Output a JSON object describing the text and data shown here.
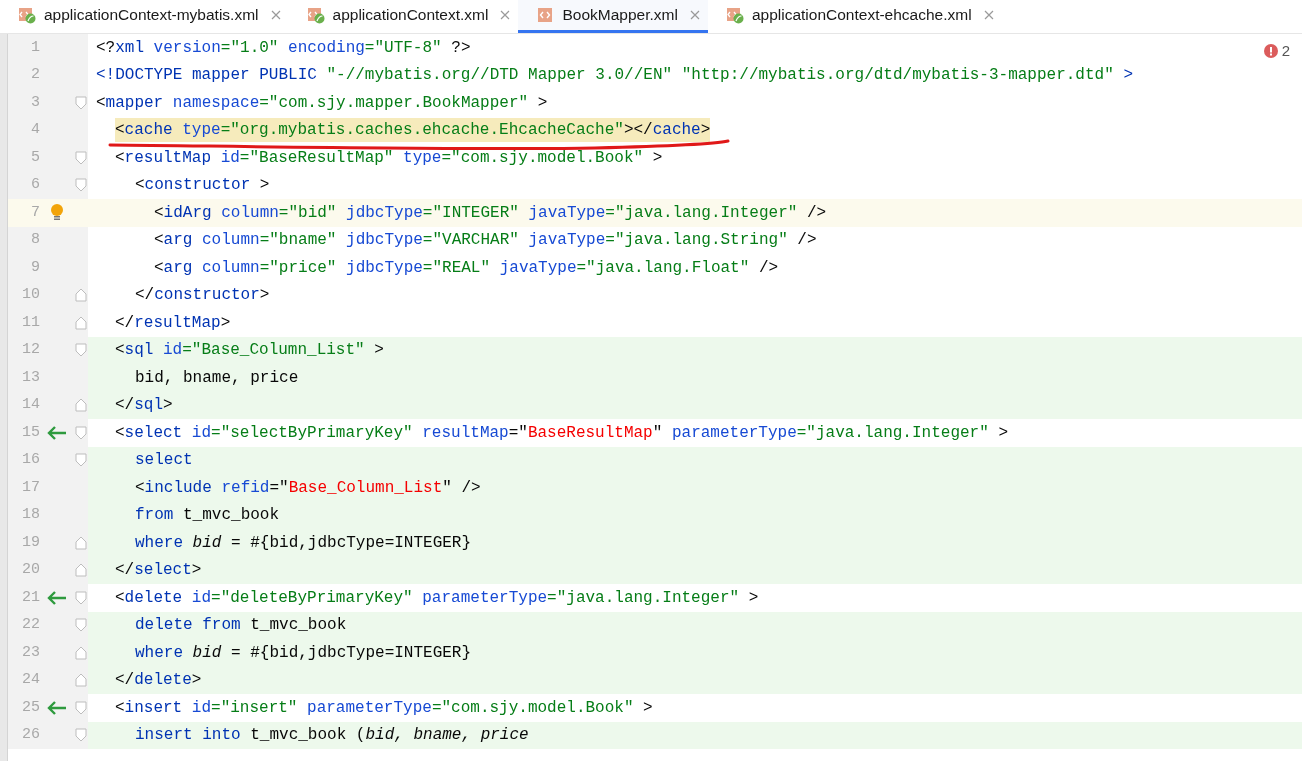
{
  "tabs": [
    {
      "label": "applicationContext-mybatis.xml",
      "selected": false,
      "kind": "spring"
    },
    {
      "label": "applicationContext.xml",
      "selected": false,
      "kind": "spring"
    },
    {
      "label": "BookMapper.xml",
      "selected": true,
      "kind": "xml"
    },
    {
      "label": "applicationContext-ehcache.xml",
      "selected": false,
      "kind": "spring"
    }
  ],
  "problems": {
    "errors": "2"
  },
  "lines": [
    {
      "number": "1",
      "fold_open": false,
      "fold_close": false,
      "arrow": false,
      "bulb": false,
      "changed": false,
      "current": false,
      "highlight": false,
      "tokens": [
        {
          "kind": "punct",
          "text": "<?"
        },
        {
          "kind": "tag",
          "text": "xml "
        },
        {
          "kind": "attr",
          "text": "version"
        },
        {
          "kind": "value",
          "text": "=\"1.0\" "
        },
        {
          "kind": "attr",
          "text": "encoding"
        },
        {
          "kind": "value",
          "text": "=\"UTF-8\" "
        },
        {
          "kind": "punct",
          "text": "?>"
        }
      ]
    },
    {
      "number": "2",
      "fold_open": false,
      "fold_close": false,
      "arrow": false,
      "bulb": false,
      "changed": false,
      "current": false,
      "highlight": false,
      "tokens": [
        {
          "kind": "tag",
          "text": "<!DOCTYPE mapper PUBLIC "
        },
        {
          "kind": "value",
          "text": "\"-//mybatis.org//DTD Mapper 3.0//EN\" \"http://mybatis.org/dtd/mybatis-3-mapper.dtd\" "
        },
        {
          "kind": "tag",
          "text": ">"
        }
      ]
    },
    {
      "number": "3",
      "fold_open": true,
      "fold_close": false,
      "arrow": false,
      "bulb": false,
      "changed": false,
      "current": false,
      "highlight": false,
      "tokens": [
        {
          "kind": "punct",
          "text": "<"
        },
        {
          "kind": "tag",
          "text": "mapper "
        },
        {
          "kind": "attr",
          "text": "namespace"
        },
        {
          "kind": "value",
          "text": "=\"com.sjy.mapper.BookMapper\" "
        },
        {
          "kind": "punct",
          "text": ">"
        }
      ],
      "children": [
        {
          "number": "4",
          "fold_open": false,
          "fold_close": false,
          "arrow": false,
          "bulb": false,
          "changed": false,
          "current": false,
          "highlight": true,
          "tokens": [
            {
              "kind": "punct",
              "text": "<"
            },
            {
              "kind": "tag",
              "text": "cache "
            },
            {
              "kind": "attr",
              "text": "type"
            },
            {
              "kind": "value",
              "text": "=\"org.mybatis.caches.ehcache.EhcacheCache\""
            },
            {
              "kind": "punct",
              "text": "></"
            },
            {
              "kind": "tag",
              "text": "cache"
            },
            {
              "kind": "punct",
              "text": ">"
            }
          ]
        },
        {
          "number": "5",
          "fold_open": true,
          "fold_close": false,
          "arrow": false,
          "bulb": false,
          "changed": false,
          "current": false,
          "highlight": false,
          "tokens": [
            {
              "kind": "punct",
              "text": "<"
            },
            {
              "kind": "tag",
              "text": "resultMap "
            },
            {
              "kind": "attr",
              "text": "id"
            },
            {
              "kind": "value",
              "text": "=\"BaseResultMap\" "
            },
            {
              "kind": "attr",
              "text": "type"
            },
            {
              "kind": "value",
              "text": "=\"com.sjy.model.Book\" "
            },
            {
              "kind": "punct",
              "text": ">"
            }
          ],
          "children": [
            {
              "number": "6",
              "fold_open": true,
              "fold_close": false,
              "arrow": false,
              "bulb": false,
              "changed": false,
              "current": false,
              "highlight": false,
              "tokens": [
                {
                  "kind": "punct",
                  "text": "<"
                },
                {
                  "kind": "tag",
                  "text": "constructor "
                },
                {
                  "kind": "punct",
                  "text": ">"
                }
              ],
              "children": [
                {
                  "number": "7",
                  "fold_open": false,
                  "fold_close": false,
                  "arrow": false,
                  "bulb": true,
                  "changed": false,
                  "current": true,
                  "highlight": false,
                  "tokens": [
                    {
                      "kind": "punct",
                      "text": "<"
                    },
                    {
                      "kind": "tag",
                      "text": "idArg "
                    },
                    {
                      "kind": "attr",
                      "text": "column"
                    },
                    {
                      "kind": "value",
                      "text": "=\"bid\" "
                    },
                    {
                      "kind": "attr",
                      "text": "jdbcType"
                    },
                    {
                      "kind": "value",
                      "text": "=\"INTEGER\" "
                    },
                    {
                      "kind": "attr",
                      "text": "javaType"
                    },
                    {
                      "kind": "value",
                      "text": "=\"java.lang.Integer\" "
                    },
                    {
                      "kind": "punct",
                      "text": "/>"
                    }
                  ]
                },
                {
                  "number": "8",
                  "fold_open": false,
                  "fold_close": false,
                  "arrow": false,
                  "bulb": false,
                  "changed": false,
                  "current": false,
                  "highlight": false,
                  "tokens": [
                    {
                      "kind": "punct",
                      "text": "<"
                    },
                    {
                      "kind": "tag",
                      "text": "arg "
                    },
                    {
                      "kind": "attr",
                      "text": "column"
                    },
                    {
                      "kind": "value",
                      "text": "=\"bname\" "
                    },
                    {
                      "kind": "attr",
                      "text": "jdbcType"
                    },
                    {
                      "kind": "value",
                      "text": "=\"VARCHAR\" "
                    },
                    {
                      "kind": "attr",
                      "text": "javaType"
                    },
                    {
                      "kind": "value",
                      "text": "=\"java.lang.String\" "
                    },
                    {
                      "kind": "punct",
                      "text": "/>"
                    }
                  ]
                },
                {
                  "number": "9",
                  "fold_open": false,
                  "fold_close": false,
                  "arrow": false,
                  "bulb": false,
                  "changed": false,
                  "current": false,
                  "highlight": false,
                  "tokens": [
                    {
                      "kind": "punct",
                      "text": "<"
                    },
                    {
                      "kind": "tag",
                      "text": "arg "
                    },
                    {
                      "kind": "attr",
                      "text": "column"
                    },
                    {
                      "kind": "value",
                      "text": "=\"price\" "
                    },
                    {
                      "kind": "attr",
                      "text": "jdbcType"
                    },
                    {
                      "kind": "value",
                      "text": "=\"REAL\" "
                    },
                    {
                      "kind": "attr",
                      "text": "javaType"
                    },
                    {
                      "kind": "value",
                      "text": "=\"java.lang.Float\" "
                    },
                    {
                      "kind": "punct",
                      "text": "/>"
                    }
                  ]
                }
              ]
            },
            {
              "number": "10",
              "fold_open": false,
              "fold_close": true,
              "arrow": false,
              "bulb": false,
              "changed": false,
              "current": false,
              "highlight": false,
              "tokens": [
                {
                  "kind": "punct",
                  "text": "</"
                },
                {
                  "kind": "tag",
                  "text": "constructor"
                },
                {
                  "kind": "punct",
                  "text": ">"
                }
              ]
            }
          ]
        },
        {
          "number": "11",
          "fold_open": false,
          "fold_close": true,
          "arrow": false,
          "bulb": false,
          "changed": false,
          "current": false,
          "highlight": false,
          "tokens": [
            {
              "kind": "punct",
              "text": "</"
            },
            {
              "kind": "tag",
              "text": "resultMap"
            },
            {
              "kind": "punct",
              "text": ">"
            }
          ]
        },
        {
          "number": "12",
          "fold_open": true,
          "fold_close": false,
          "arrow": false,
          "bulb": false,
          "changed": true,
          "current": false,
          "highlight": false,
          "tokens": [
            {
              "kind": "punct",
              "text": "<"
            },
            {
              "kind": "tag",
              "text": "sql "
            },
            {
              "kind": "attr",
              "text": "id"
            },
            {
              "kind": "value",
              "text": "=\"Base_Column_List\" "
            },
            {
              "kind": "punct",
              "text": ">"
            }
          ],
          "children": [
            {
              "number": "13",
              "fold_open": false,
              "fold_close": false,
              "arrow": false,
              "bulb": false,
              "changed": true,
              "current": false,
              "highlight": false,
              "tokens": [
                {
                  "kind": "text",
                  "text": "bid, bname, price"
                }
              ]
            }
          ]
        },
        {
          "number": "14",
          "fold_open": false,
          "fold_close": true,
          "arrow": false,
          "bulb": false,
          "changed": true,
          "current": false,
          "highlight": false,
          "tokens": [
            {
              "kind": "punct",
              "text": "</"
            },
            {
              "kind": "tag",
              "text": "sql"
            },
            {
              "kind": "punct",
              "text": ">"
            }
          ]
        },
        {
          "number": "15",
          "fold_open": true,
          "fold_close": false,
          "arrow": true,
          "bulb": false,
          "changed": false,
          "current": false,
          "highlight": false,
          "tokens": [
            {
              "kind": "punct",
              "text": "<"
            },
            {
              "kind": "tag",
              "text": "select "
            },
            {
              "kind": "attr",
              "text": "id"
            },
            {
              "kind": "value",
              "text": "=\"selectByPrimaryKey\" "
            },
            {
              "kind": "attr",
              "text": "resultMap"
            },
            {
              "kind": "punct",
              "text": "=\""
            },
            {
              "kind": "ref",
              "text": "BaseResultMap"
            },
            {
              "kind": "punct",
              "text": "\" "
            },
            {
              "kind": "attr",
              "text": "parameterType"
            },
            {
              "kind": "value",
              "text": "=\"java.lang.Integer\" "
            },
            {
              "kind": "punct",
              "text": ">"
            }
          ],
          "children": [
            {
              "number": "16",
              "fold_open": true,
              "fold_close": false,
              "arrow": false,
              "bulb": false,
              "changed": true,
              "current": false,
              "highlight": false,
              "tokens": [
                {
                  "kind": "keyword",
                  "text": "select"
                }
              ]
            },
            {
              "number": "17",
              "fold_open": false,
              "fold_close": false,
              "arrow": false,
              "bulb": false,
              "changed": true,
              "current": false,
              "highlight": false,
              "tokens": [
                {
                  "kind": "punct",
                  "text": "<"
                },
                {
                  "kind": "tag",
                  "text": "include "
                },
                {
                  "kind": "attr",
                  "text": "refid"
                },
                {
                  "kind": "punct",
                  "text": "=\""
                },
                {
                  "kind": "ref",
                  "text": "Base_Column_List"
                },
                {
                  "kind": "punct",
                  "text": "\" />"
                }
              ]
            },
            {
              "number": "18",
              "fold_open": false,
              "fold_close": false,
              "arrow": false,
              "bulb": false,
              "changed": true,
              "current": false,
              "highlight": false,
              "tokens": [
                {
                  "kind": "keyword",
                  "text": "from "
                },
                {
                  "kind": "text",
                  "text": "t_mvc_book"
                }
              ]
            },
            {
              "number": "19",
              "fold_open": false,
              "fold_close": true,
              "arrow": false,
              "bulb": false,
              "changed": true,
              "current": false,
              "highlight": false,
              "tokens": [
                {
                  "kind": "keyword",
                  "text": "where "
                },
                {
                  "kind": "italic",
                  "text": "bid"
                },
                {
                  "kind": "text",
                  "text": " = #{bid,jdbcType=INTEGER}"
                }
              ]
            }
          ]
        },
        {
          "number": "20",
          "fold_open": false,
          "fold_close": true,
          "arrow": false,
          "bulb": false,
          "changed": true,
          "current": false,
          "highlight": false,
          "tokens": [
            {
              "kind": "punct",
              "text": "</"
            },
            {
              "kind": "tag",
              "text": "select"
            },
            {
              "kind": "punct",
              "text": ">"
            }
          ]
        },
        {
          "number": "21",
          "fold_open": true,
          "fold_close": false,
          "arrow": true,
          "bulb": false,
          "changed": false,
          "current": false,
          "highlight": false,
          "tokens": [
            {
              "kind": "punct",
              "text": "<"
            },
            {
              "kind": "tag",
              "text": "delete "
            },
            {
              "kind": "attr",
              "text": "id"
            },
            {
              "kind": "value",
              "text": "=\"deleteByPrimaryKey\" "
            },
            {
              "kind": "attr",
              "text": "parameterType"
            },
            {
              "kind": "value",
              "text": "=\"java.lang.Integer\" "
            },
            {
              "kind": "punct",
              "text": ">"
            }
          ],
          "children": [
            {
              "number": "22",
              "fold_open": true,
              "fold_close": false,
              "arrow": false,
              "bulb": false,
              "changed": true,
              "current": false,
              "highlight": false,
              "tokens": [
                {
                  "kind": "keyword",
                  "text": "delete from "
                },
                {
                  "kind": "text",
                  "text": "t_mvc_book"
                }
              ]
            },
            {
              "number": "23",
              "fold_open": false,
              "fold_close": true,
              "arrow": false,
              "bulb": false,
              "changed": true,
              "current": false,
              "highlight": false,
              "tokens": [
                {
                  "kind": "keyword",
                  "text": "where "
                },
                {
                  "kind": "italic",
                  "text": "bid"
                },
                {
                  "kind": "text",
                  "text": " = #{bid,jdbcType=INTEGER}"
                }
              ]
            }
          ]
        },
        {
          "number": "24",
          "fold_open": false,
          "fold_close": true,
          "arrow": false,
          "bulb": false,
          "changed": true,
          "current": false,
          "highlight": false,
          "tokens": [
            {
              "kind": "punct",
              "text": "</"
            },
            {
              "kind": "tag",
              "text": "delete"
            },
            {
              "kind": "punct",
              "text": ">"
            }
          ]
        },
        {
          "number": "25",
          "fold_open": true,
          "fold_close": false,
          "arrow": true,
          "bulb": false,
          "changed": false,
          "current": false,
          "highlight": false,
          "tokens": [
            {
              "kind": "punct",
              "text": "<"
            },
            {
              "kind": "tag",
              "text": "insert "
            },
            {
              "kind": "attr",
              "text": "id"
            },
            {
              "kind": "value",
              "text": "=\"insert\" "
            },
            {
              "kind": "attr",
              "text": "parameterType"
            },
            {
              "kind": "value",
              "text": "=\"com.sjy.model.Book\" "
            },
            {
              "kind": "punct",
              "text": ">"
            }
          ],
          "children": [
            {
              "number": "26",
              "fold_open": true,
              "fold_close": false,
              "arrow": false,
              "bulb": false,
              "changed": true,
              "current": false,
              "highlight": false,
              "tokens": [
                {
                  "kind": "keyword",
                  "text": "insert into "
                },
                {
                  "kind": "text",
                  "text": "t_mvc_book ("
                },
                {
                  "kind": "italic",
                  "text": "bid, bname, price"
                }
              ]
            }
          ]
        }
      ]
    }
  ]
}
